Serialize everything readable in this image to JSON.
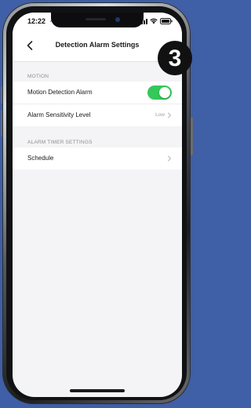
{
  "status_bar": {
    "time": "12:22",
    "location_arrow": "↗"
  },
  "nav": {
    "title": "Detection Alarm Settings",
    "back_icon": "chevron-left-icon"
  },
  "badge": {
    "label": "3"
  },
  "sections": {
    "motion": {
      "header": "MOTION",
      "rows": {
        "motion_detection": {
          "label": "Motion Detection Alarm",
          "toggle_on": true
        },
        "sensitivity": {
          "label": "Alarm Sensitivity Level",
          "value": "Low"
        }
      }
    },
    "timer": {
      "header": "ALARM TIMER SETTINGS",
      "rows": {
        "schedule": {
          "label": "Schedule"
        }
      }
    }
  },
  "colors": {
    "toggle_on": "#34c759",
    "background": "#3f5fa6"
  }
}
